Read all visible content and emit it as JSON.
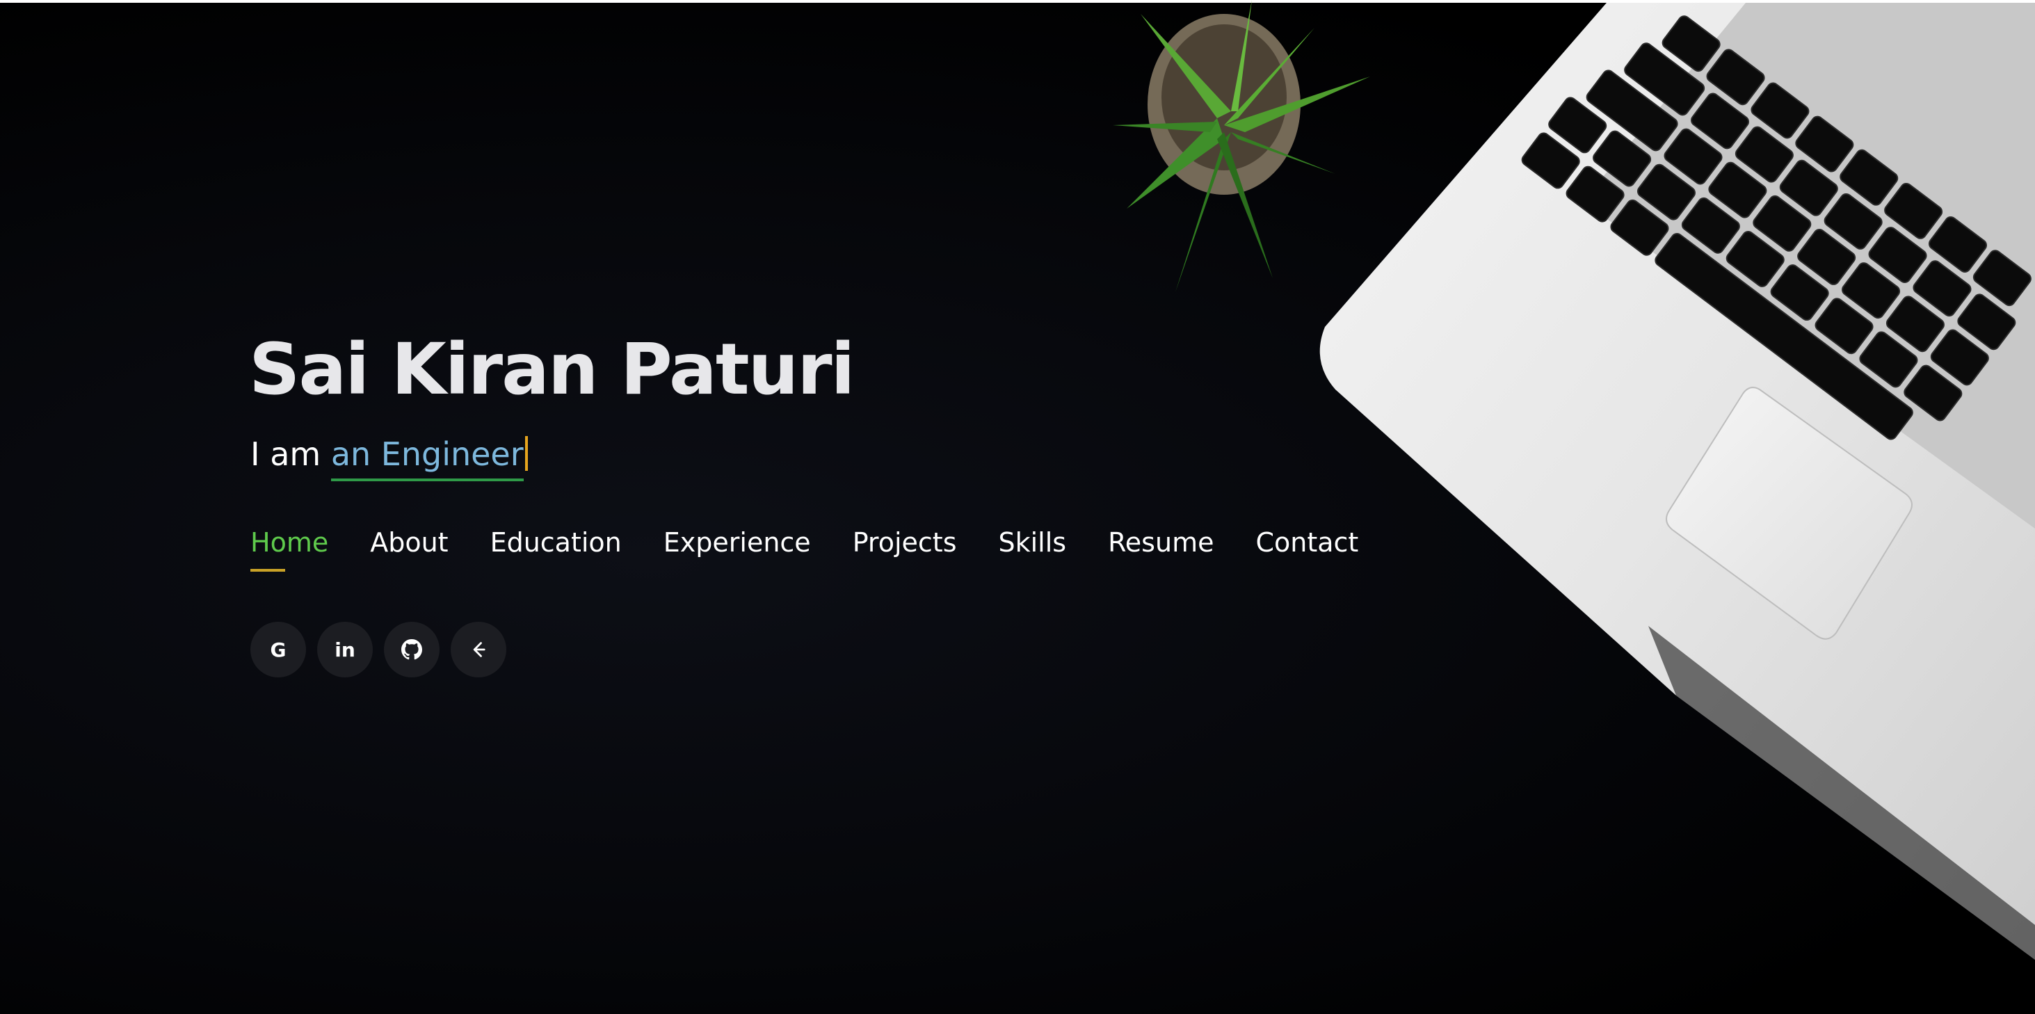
{
  "hero": {
    "name": "Sai Kiran Paturi",
    "role_prefix": "I am",
    "role_typed": "an Engineer"
  },
  "nav": {
    "items": [
      {
        "label": "Home",
        "active": true
      },
      {
        "label": "About",
        "active": false
      },
      {
        "label": "Education",
        "active": false
      },
      {
        "label": "Experience",
        "active": false
      },
      {
        "label": "Projects",
        "active": false
      },
      {
        "label": "Skills",
        "active": false
      },
      {
        "label": "Resume",
        "active": false
      },
      {
        "label": "Contact",
        "active": false
      }
    ]
  },
  "socials": [
    {
      "icon": "google-icon",
      "glyph": "G"
    },
    {
      "icon": "linkedin-icon",
      "glyph": "in"
    },
    {
      "icon": "github-icon",
      "glyph": ""
    },
    {
      "icon": "leetcode-icon",
      "glyph": ""
    }
  ],
  "colors": {
    "background": "#000000",
    "name": "#e7e7ea",
    "role_typed": "#7db8dd",
    "role_underline": "#2f9a48",
    "cursor": "#e6a51e",
    "nav_active": "#5fcb4c",
    "nav_active_underline": "#c9a227",
    "social_button_bg": "#1c1d22"
  }
}
